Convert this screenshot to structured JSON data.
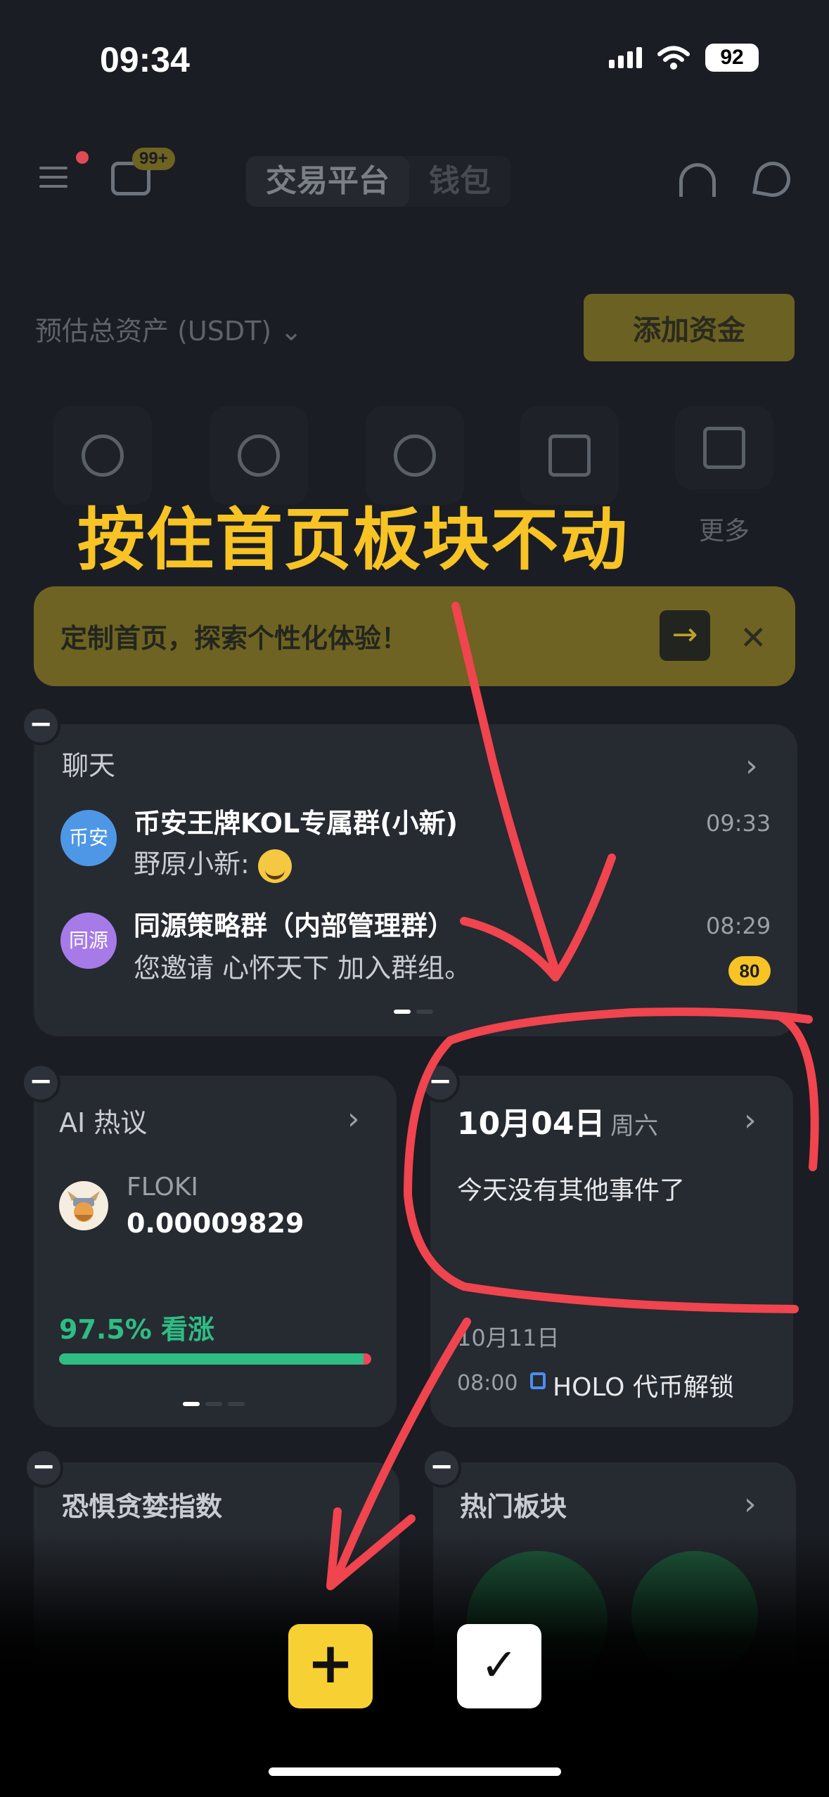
{
  "status": {
    "time": "09:34",
    "battery": "92"
  },
  "header": {
    "badge": "99+",
    "tab_exchange": "交易平台",
    "tab_wallet": "钱包"
  },
  "assets": {
    "label": "预估总资产 (USDT)",
    "add_funds": "添加资金"
  },
  "quick_actions": {
    "more_label": "更多"
  },
  "overlay": {
    "instruction": "按住首页板块不动"
  },
  "promo": {
    "text": "定制首页，探索个性化体验！"
  },
  "chat": {
    "title": "聊天",
    "items": [
      {
        "avatar": "币安",
        "name": "币安王牌KOL专属群(小新)",
        "message": "野原小新:",
        "time": "09:33"
      },
      {
        "avatar": "同源",
        "name": "同源策略群（内部管理群）",
        "message": "您邀请 心怀天下 加入群组。",
        "time": "08:29",
        "badge": "80"
      }
    ]
  },
  "ai": {
    "title": "AI 热议",
    "coin": "FLOKI",
    "price": "0.00009829",
    "sentiment": "97.5% 看涨",
    "bull_fraction": 0.975
  },
  "calendar": {
    "date": "10月04日",
    "weekday": "周六",
    "no_events": "今天没有其他事件了",
    "next_date": "10月11日",
    "event_time": "08:00",
    "event": "HOLO 代币解锁"
  },
  "fear": {
    "title": "恐惧贪婪指数"
  },
  "hot": {
    "title": "热门板块"
  },
  "colors": {
    "accent": "#f7c325",
    "bull": "#2ebd85",
    "bear": "#f0455b",
    "annotation": "#f0444e"
  }
}
